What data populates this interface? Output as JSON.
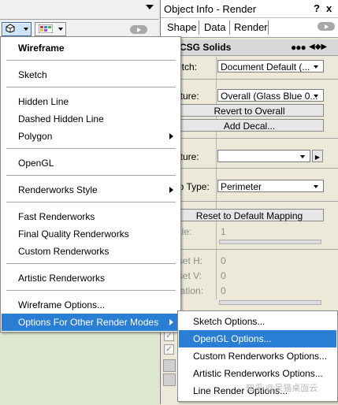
{
  "object_info": {
    "title": "Object Info - Render",
    "help": "?",
    "close": "x",
    "tabs": [
      "Shape",
      "Data",
      "Render"
    ],
    "header_title": "CSG Solids",
    "header_dots": "●●●",
    "header_nav": "◀◆▶",
    "rows": {
      "sketch_label": "Sketch:",
      "sketch_value": "Document Default (...",
      "texture_label": "Texture:",
      "texture_value": "Overall (Glass Blue 0...",
      "revert_button": "Revert to Overall",
      "add_decal_button": "Add Decal...",
      "texture2_label": "Texture:",
      "texture2_value": "",
      "map_type_label": "Map Type:",
      "map_type_value": "Perimeter",
      "reset_button": "Reset to Default Mapping",
      "scale_label": "Scale:",
      "scale_value": "1",
      "offset_h_label": "Offset H:",
      "offset_h_value": "0",
      "offset_v_label": "Offset V:",
      "offset_v_value": "0",
      "rotation_label": "Rotation:",
      "rotation_value": "0"
    }
  },
  "menu": {
    "items": [
      {
        "label": "Wireframe",
        "bold": true
      },
      {
        "label": "Sketch"
      },
      {
        "label": "Hidden Line"
      },
      {
        "label": "Dashed Hidden Line"
      },
      {
        "label": "Polygon",
        "submenu": true
      },
      {
        "label": "OpenGL"
      },
      {
        "label": "Renderworks Style",
        "submenu": true
      },
      {
        "label": "Fast Renderworks"
      },
      {
        "label": "Final Quality Renderworks"
      },
      {
        "label": "Custom Renderworks"
      },
      {
        "label": "Artistic Renderworks"
      },
      {
        "label": "Wireframe Options..."
      },
      {
        "label": "Options For Other Render Modes",
        "submenu": true,
        "highlighted": true
      }
    ]
  },
  "submenu": {
    "items": [
      {
        "label": "Sketch Options..."
      },
      {
        "label": "OpenGL Options...",
        "highlighted": true
      },
      {
        "label": "Custom Renderworks Options..."
      },
      {
        "label": "Artistic Renderworks Options..."
      },
      {
        "label": "Line Render Options..."
      }
    ]
  },
  "watermark": "知乎 @呆猫桌面云",
  "colors": {
    "highlight": "#2a7fd4",
    "drawing_area": "#dde6cf"
  }
}
